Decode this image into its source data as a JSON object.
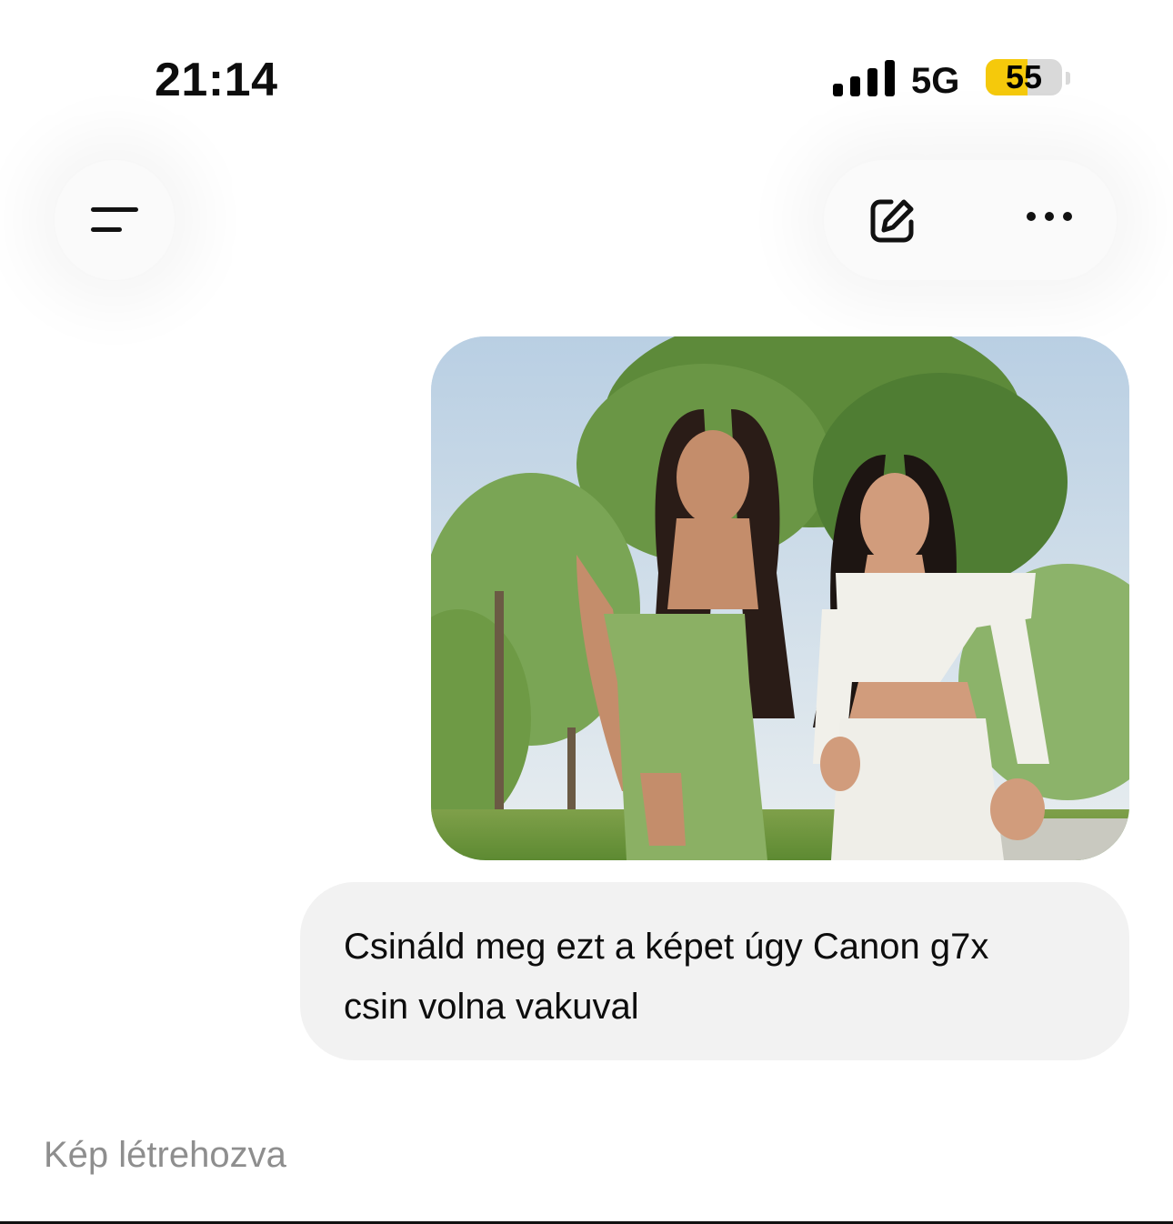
{
  "status_bar": {
    "time": "21:14",
    "network": "5G",
    "battery_level": "55",
    "battery_fraction": 0.55,
    "signal_bars": 4
  },
  "header": {
    "menu_icon": "sidebar-menu-icon",
    "edit_icon": "new-chat-edit-icon",
    "more_icon": "ellipsis-icon"
  },
  "conversation": {
    "attached_image_alt": "",
    "user_message": "Csináld meg ezt a képet úgy Canon g7x\ncsin volna vakuval",
    "status_caption": "Kép létrehozva"
  },
  "colors": {
    "battery_accent": "#f5c90b",
    "bubble_bg": "#f2f2f2",
    "caption": "#8e8e8e"
  }
}
